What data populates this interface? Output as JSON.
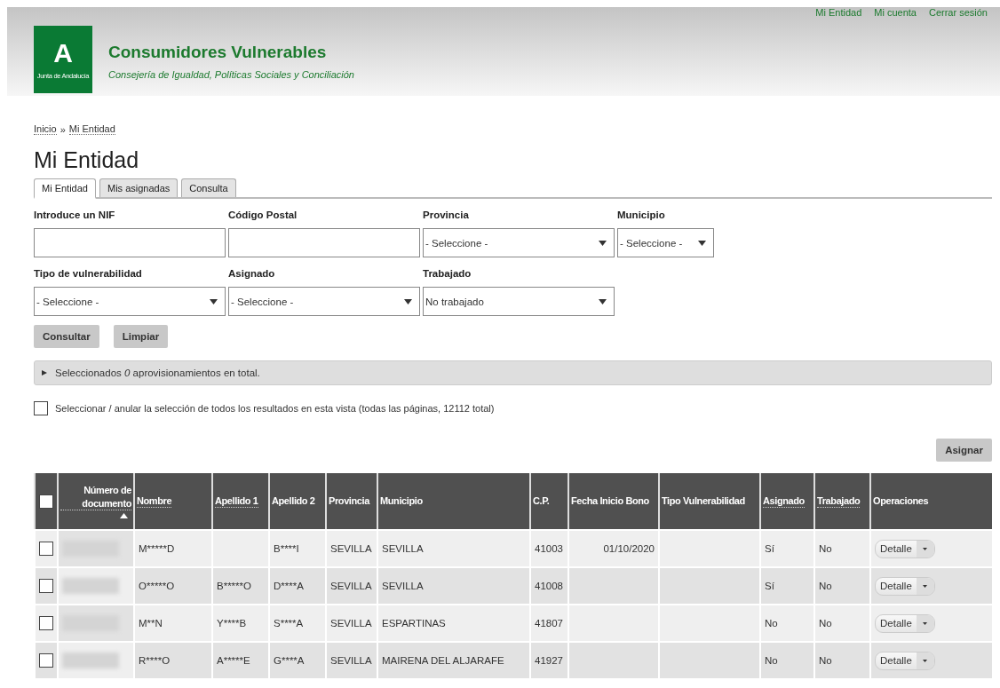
{
  "header": {
    "logo_letter": "A",
    "logo_caption": "Junta de Andalucía",
    "title": "Consumidores Vulnerables",
    "subtitle": "Consejería de Igualdad, Políticas Sociales y Conciliación",
    "top_links": [
      "Mi Entidad",
      "Mi cuenta",
      "Cerrar sesión"
    ]
  },
  "breadcrumb": {
    "items": [
      "Inicio",
      "Mi Entidad"
    ],
    "separator": "»"
  },
  "page_title": "Mi Entidad",
  "tabs": [
    {
      "label": "Mi Entidad",
      "selected": true
    },
    {
      "label": "Mis asignadas",
      "selected": false
    },
    {
      "label": "Consulta",
      "selected": false
    }
  ],
  "filter_rows": [
    [
      {
        "label": "Introduce un NIF",
        "kind": "text"
      },
      {
        "label": "Código Postal",
        "kind": "text"
      },
      {
        "label": "Provincia",
        "kind": "select",
        "value": "- Seleccione -"
      },
      {
        "label": "Municipio",
        "kind": "select-small",
        "value": "- Seleccione -"
      }
    ],
    [
      {
        "label": "Tipo de vulnerabilidad",
        "kind": "select",
        "value": "- Seleccione -"
      },
      {
        "label": "Asignado",
        "kind": "select",
        "value": "- Seleccione -"
      },
      {
        "label": "Trabajado",
        "kind": "select",
        "value": "No trabajado"
      }
    ]
  ],
  "buttons": [
    "Consultar",
    "Limpiar"
  ],
  "summary": {
    "text": "Seleccionados *0* aprovisionamientos en total.",
    "expanded": false
  },
  "select_all": {
    "label": "Seleccionar / anular la selección de todos los resultados en esta vista (todas las páginas, 12112 total)",
    "checked": false
  },
  "assign_button": "Asignar",
  "table": {
    "header_checked": false,
    "columns": [
      {
        "label": "Número de documento",
        "sortable": true,
        "sorted": true
      },
      {
        "label": "Nombre",
        "sortable": true,
        "sorted": false
      },
      {
        "label": "Apellido 1",
        "sortable": true,
        "sorted": false
      },
      {
        "label": "Apellido 2",
        "sortable": false,
        "sorted": false
      },
      {
        "label": "Provincia",
        "sortable": false,
        "sorted": false
      },
      {
        "label": "Municipio",
        "sortable": false,
        "sorted": false
      },
      {
        "label": "C.P.",
        "sortable": false,
        "sorted": false
      },
      {
        "label": "Fecha Inicio Bono",
        "sortable": false,
        "sorted": false
      },
      {
        "label": "Tipo Vulnerabilidad",
        "sortable": false,
        "sorted": false
      },
      {
        "label": "Asignado",
        "sortable": true,
        "sorted": false
      },
      {
        "label": "Trabajado",
        "sortable": true,
        "sorted": false
      },
      {
        "label": "Operaciones",
        "sortable": false,
        "sorted": false
      }
    ],
    "rows": [
      {
        "checked": false,
        "nombre": "M*****D",
        "apellido_2": "B****I",
        "provincia": "SEVILLA",
        "municipio": "SEVILLA",
        "cp": "41003",
        "fecha": "01/10/2020",
        "asignado": "Sí",
        "trabajado": "No",
        "operation": "Detalle"
      },
      {
        "checked": false,
        "nombre": "O*****O",
        "apellido_1": "B*****O",
        "apellido_2": "D****A",
        "provincia": "SEVILLA",
        "municipio": "SEVILLA",
        "cp": "41008",
        "asignado": "Sí",
        "trabajado": "No",
        "operation": "Detalle"
      },
      {
        "checked": false,
        "nombre": "M**N",
        "apellido_1": "Y****B",
        "apellido_2": "S****A",
        "provincia": "SEVILLA",
        "municipio": "ESPARTINAS",
        "cp": "41807",
        "asignado": "No",
        "trabajado": "No",
        "operation": "Detalle"
      },
      {
        "checked": false,
        "nombre": "R****O",
        "apellido_1": "A*****E",
        "apellido_2": "G****A",
        "provincia": "SEVILLA",
        "municipio": "MAIRENA DEL ALJARAFE",
        "cp": "41927",
        "asignado": "No",
        "trabajado": "No",
        "operation": "Detalle"
      }
    ]
  }
}
